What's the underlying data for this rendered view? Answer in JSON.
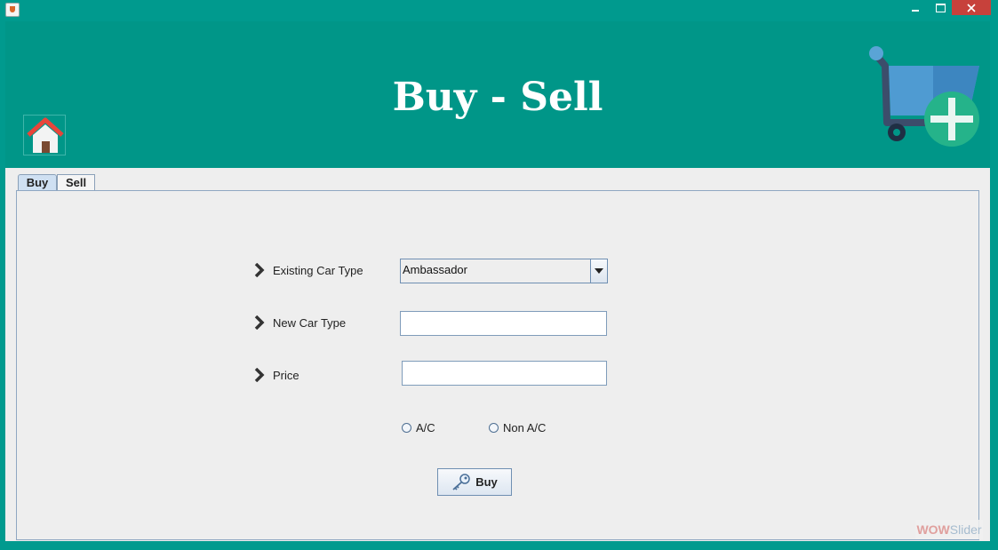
{
  "window": {
    "controls": {
      "minimize_icon": "minimize-icon",
      "maximize_icon": "maximize-icon",
      "close_icon": "close-icon"
    }
  },
  "header": {
    "title": "Buy - Sell",
    "background": "#009688",
    "home_icon": "home-icon",
    "cart_icon": "cart-add-icon"
  },
  "tabs": [
    {
      "label": "Buy",
      "selected": true
    },
    {
      "label": "Sell",
      "selected": false
    }
  ],
  "form": {
    "existing_car_type": {
      "label": "Existing Car Type",
      "value": "Ambassador"
    },
    "new_car_type": {
      "label": "New Car Type",
      "value": ""
    },
    "price": {
      "label": "Price",
      "value": ""
    },
    "radios": [
      {
        "label": "A/C",
        "checked": false
      },
      {
        "label": "Non A/C",
        "checked": false
      }
    ],
    "buy_button": "Buy",
    "key_icon": "key-icon"
  },
  "watermark": {
    "part1": "WOW",
    "part2": "Slider"
  }
}
